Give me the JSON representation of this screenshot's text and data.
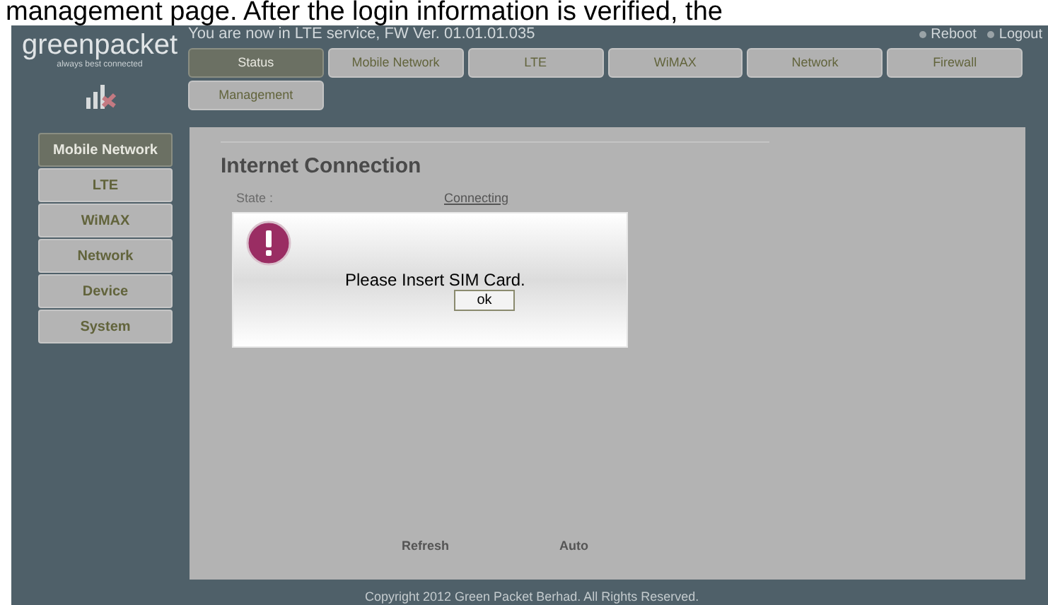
{
  "caption_fragment": "management page. After the login information is verified, the",
  "header": {
    "logo_name": "greenpacket",
    "logo_tagline": "always best connected",
    "service_info": "You are now in LTE service, FW Ver. 01.01.01.035",
    "links": [
      {
        "label": "Reboot"
      },
      {
        "label": "Logout"
      }
    ]
  },
  "tabs": [
    {
      "label": "Status",
      "selected": true
    },
    {
      "label": "Mobile Network",
      "selected": false
    },
    {
      "label": "LTE",
      "selected": false
    },
    {
      "label": "WiMAX",
      "selected": false
    },
    {
      "label": "Network",
      "selected": false
    },
    {
      "label": "Firewall",
      "selected": false
    },
    {
      "label": "Management",
      "selected": false
    }
  ],
  "sidebar": {
    "items": [
      {
        "label": "Mobile Network",
        "selected": true
      },
      {
        "label": "LTE",
        "selected": false
      },
      {
        "label": "WiMAX",
        "selected": false
      },
      {
        "label": "Network",
        "selected": false
      },
      {
        "label": "Device",
        "selected": false
      },
      {
        "label": "System",
        "selected": false
      }
    ]
  },
  "content": {
    "title": "Internet Connection",
    "state_label": "State :",
    "state_value": "Connecting",
    "actions": [
      {
        "label": "Refresh"
      },
      {
        "label": "Auto"
      }
    ]
  },
  "dialog": {
    "message": "Please Insert SIM Card.",
    "button": "ok"
  },
  "footer": "Copyright 2012 Green Packet Berhad. All Rights Reserved."
}
